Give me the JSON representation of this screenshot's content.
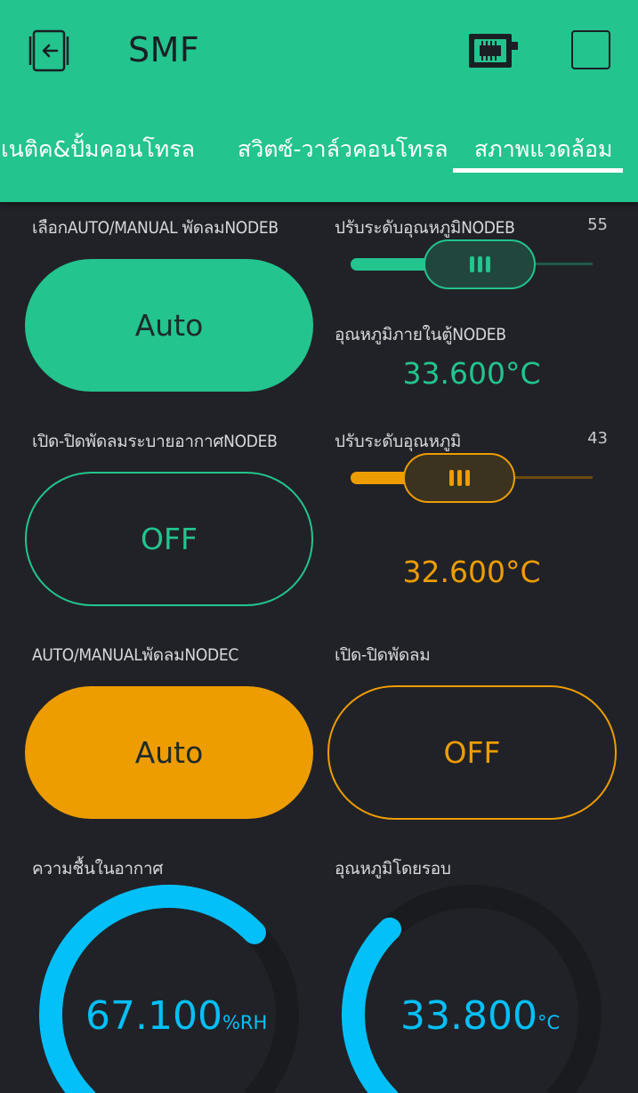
{
  "header": {
    "title": "SMF",
    "exit_icon": "exit-icon",
    "device_icon": "device-chip-icon",
    "square_icon": "square-icon"
  },
  "tabs": [
    {
      "label": "แมคเนติค&ปั้มคอนโทรล",
      "active": false
    },
    {
      "label": "สวิตซ์-วาล์วคอนโทรล",
      "active": false
    },
    {
      "label": "สภาพแวดล้อม",
      "active": true
    }
  ],
  "widgets": {
    "auto_manual_fan_nodeb": {
      "label": "เลือกAUTO/MANUAL พัดลมNODEB",
      "state": "Auto"
    },
    "temp_slider_nodeb": {
      "label": "ปรับระดับอุณหภูมิNODEB",
      "value": "55",
      "fraction": 0.55
    },
    "cabinet_temp_nodeb": {
      "label": "อุณหภูมิภายในตู้NODEB",
      "value": "33.600°C"
    },
    "fan_vent_nodeb": {
      "label": "เปิด-ปิดพัดลมระบายอากาศNODEB",
      "state": "OFF"
    },
    "temp_slider": {
      "label": "ปรับระดับอุณหภูมิ",
      "value": "43",
      "fraction": 0.43
    },
    "temp_display": {
      "value": "32.600°C"
    },
    "auto_manual_fan_nodec": {
      "label": "AUTO/MANUALพัดลมNODEC",
      "state": "Auto"
    },
    "fan_toggle": {
      "label": "เปิด-ปิดพัดลม",
      "state": "OFF"
    },
    "humidity_gauge": {
      "label": "ความชื้นในอากาศ",
      "value": "67.100",
      "unit": "%RH",
      "fraction": 0.671
    },
    "ambient_temp_gauge": {
      "label": "อุณหภูมิโดยรอบ",
      "value": "33.800",
      "unit": "°C",
      "fraction": 0.338
    }
  },
  "colors": {
    "green": "#23C48E",
    "orange": "#ED9D00",
    "blue": "#04C0F8",
    "background": "#212227"
  }
}
